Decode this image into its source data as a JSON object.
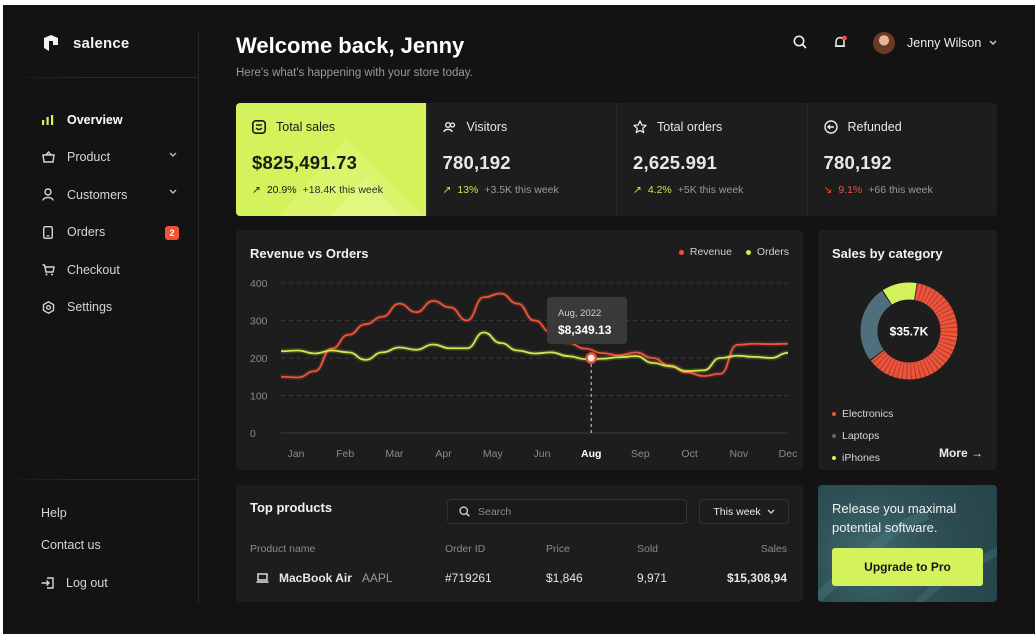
{
  "brand": {
    "name": "salence"
  },
  "sidebar": {
    "items": [
      {
        "label": "Overview",
        "icon": "bar-chart-icon",
        "active": true
      },
      {
        "label": "Product",
        "icon": "bag-icon",
        "has_chevron": true
      },
      {
        "label": "Customers",
        "icon": "user-icon",
        "has_chevron": true
      },
      {
        "label": "Orders",
        "icon": "tablet-icon",
        "badge": "2"
      },
      {
        "label": "Checkout",
        "icon": "cart-icon"
      },
      {
        "label": "Settings",
        "icon": "settings-icon"
      }
    ],
    "help": "Help",
    "contact": "Contact us",
    "logout": "Log out"
  },
  "header": {
    "title": "Welcome back, Jenny",
    "subtitle": "Here's what's happening with your store today.",
    "user_name": "Jenny Wilson"
  },
  "stats": [
    {
      "label": "Total sales",
      "value": "$825,491.73",
      "delta": "20.9%",
      "trend": "up",
      "extra": "+18.4K this week"
    },
    {
      "label": "Visitors",
      "value": "780,192",
      "delta": "13%",
      "trend": "up",
      "extra": "+3.5K this week"
    },
    {
      "label": "Total orders",
      "value": "2,625.991",
      "delta": "4.2%",
      "trend": "up",
      "extra": "+5K this week"
    },
    {
      "label": "Refunded",
      "value": "780,192",
      "delta": "9.1%",
      "trend": "down",
      "extra": "+66 this week"
    }
  ],
  "revenue_chart": {
    "title": "Revenue vs Orders",
    "legend": [
      "Revenue",
      "Orders"
    ],
    "tooltip": {
      "date": "Aug, 2022",
      "value": "$8,349.13"
    },
    "active_month": "Aug"
  },
  "chart_data": {
    "type": "line",
    "title": "Revenue vs Orders",
    "x": [
      "Jan",
      "Feb",
      "Mar",
      "Apr",
      "May",
      "Jun",
      "Aug",
      "Sep",
      "Oct",
      "Nov",
      "Dec"
    ],
    "yticks": [
      0,
      100,
      200,
      300,
      400
    ],
    "ylim": [
      0,
      400
    ],
    "series": [
      {
        "name": "Revenue",
        "color": "#f0533a",
        "values": [
          150,
          148,
          165,
          225,
          262,
          290,
          310,
          345,
          322,
          352,
          335,
          300,
          362,
          372,
          345,
          300,
          268,
          240,
          225,
          213,
          207,
          215,
          200,
          180,
          162,
          152,
          158,
          235,
          238,
          237,
          238
        ]
      },
      {
        "name": "Orders",
        "color": "#cfe84f",
        "values": [
          218,
          220,
          212,
          220,
          215,
          195,
          215,
          228,
          222,
          236,
          226,
          226,
          268,
          240,
          220,
          212,
          215,
          205,
          197,
          198,
          202,
          205,
          187,
          178,
          165,
          167,
          200,
          206,
          203,
          200,
          214
        ]
      }
    ],
    "grid": true,
    "legend_position": "top-right"
  },
  "category": {
    "title": "Sales by category",
    "center": "$35.7K",
    "items": [
      {
        "label": "Electronics",
        "color": "#f0533a",
        "share": 0.62
      },
      {
        "label": "Laptops",
        "color": "#4f6f7c",
        "share": 0.26
      },
      {
        "label": "iPhones",
        "color": "#d4f25b",
        "share": 0.12
      }
    ],
    "more": "More"
  },
  "products": {
    "title": "Top products",
    "search_placeholder": "Search",
    "period": "This week",
    "headers": [
      "Product name",
      "Order ID",
      "Price",
      "Sold",
      "Sales"
    ],
    "rows": [
      {
        "name": "MacBook Air",
        "brand": "AAPL",
        "order": "#719261",
        "price": "$1,846",
        "sold": "9,971",
        "sales": "$15,308,94"
      }
    ]
  },
  "upgrade": {
    "text": "Release you maximal potential software.",
    "button": "Upgrade to Pro"
  }
}
